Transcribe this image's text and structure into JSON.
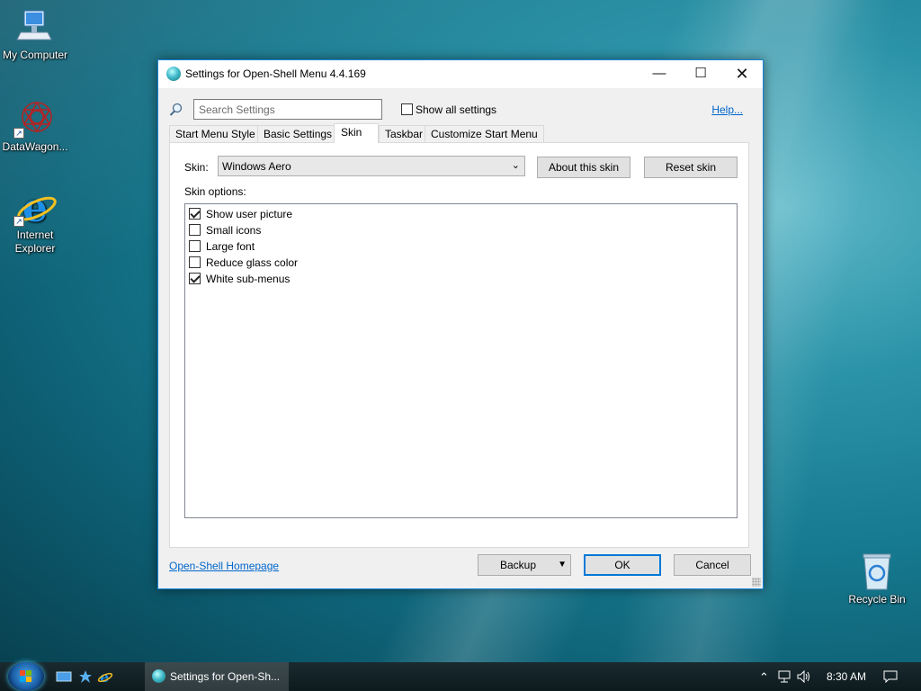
{
  "desktop": {
    "icons": [
      {
        "label": "My Computer",
        "icon": "computer-icon"
      },
      {
        "label": "DataWagon...",
        "icon": "datawagon-icon"
      },
      {
        "label": "Internet\nExplorer",
        "icon": "internet-explorer-icon"
      },
      {
        "label": "Recycle Bin",
        "icon": "recycle-bin-icon"
      }
    ]
  },
  "dialog": {
    "title": "Settings for Open-Shell Menu 4.4.169",
    "search_placeholder": "Search Settings",
    "show_all_label": "Show all settings",
    "show_all_checked": false,
    "help_link": "Help...",
    "tabs": [
      {
        "label": "Start Menu Style",
        "active": false
      },
      {
        "label": "Basic Settings",
        "active": false
      },
      {
        "label": "Skin",
        "active": true
      },
      {
        "label": "Taskbar",
        "active": false
      },
      {
        "label": "Customize Start Menu",
        "active": false
      }
    ],
    "skin": {
      "label": "Skin:",
      "selected": "Windows Aero",
      "about_button": "About this skin",
      "reset_button": "Reset skin",
      "options_label": "Skin options:",
      "options": [
        {
          "label": "Show user picture",
          "checked": true
        },
        {
          "label": "Small icons",
          "checked": false
        },
        {
          "label": "Large font",
          "checked": false
        },
        {
          "label": "Reduce glass color",
          "checked": false
        },
        {
          "label": "White sub-menus",
          "checked": true
        }
      ]
    },
    "footer": {
      "homepage_link": "Open-Shell Homepage",
      "backup_button": "Backup",
      "ok_button": "OK",
      "cancel_button": "Cancel"
    }
  },
  "taskbar": {
    "active_window": "Settings for Open-Sh...",
    "clock": "8:30 AM"
  },
  "colors": {
    "accent": "#0078d7",
    "link": "#0066cc",
    "dialog_border": "#1883d7"
  }
}
